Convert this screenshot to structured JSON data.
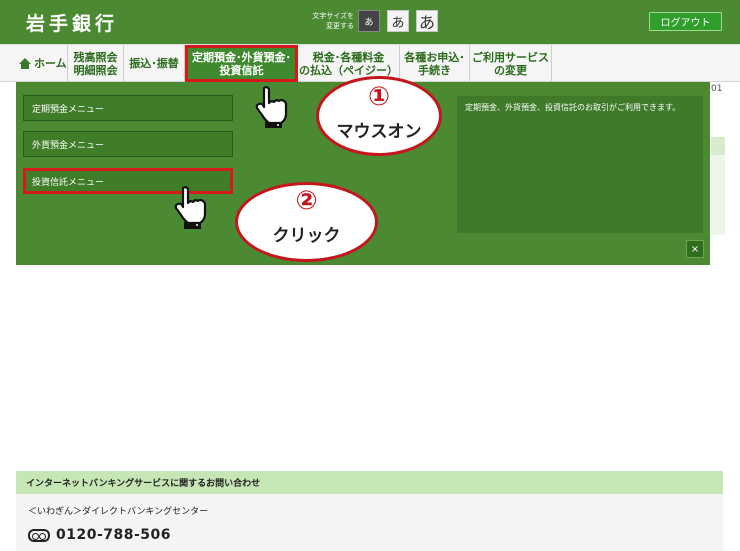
{
  "header": {
    "logo": "岩手銀行",
    "font_size_label_line1": "文字サイズを",
    "font_size_label_line2": "変更する",
    "font_buttons": [
      "あ",
      "あ",
      "あ"
    ],
    "logout_label": "ログアウト"
  },
  "nav": {
    "home": "ホーム",
    "balance_line1": "残高照会",
    "balance_line2": "明細照会",
    "transfer": "振込･振替",
    "deposit_line1": "定期預金･外貨預金･",
    "deposit_line2": "投資信託",
    "tax_line1": "税金･各種料金",
    "tax_line2": "の払込（ペイジー）",
    "apply_line1": "各種お申込･",
    "apply_line2": "手続き",
    "service_line1": "ご利用サービス",
    "service_line2": "の変更"
  },
  "side_text": "01",
  "dropdown": {
    "items": [
      "定期預金メニュー",
      "外貨預金メニュー",
      "投資信託メニュー"
    ],
    "description": "定期預金、外貨預金、投資信託のお取引がご利用できます。",
    "close": "×"
  },
  "callouts": {
    "step1_num": "①",
    "step1_text": "マウスオン",
    "step2_num": "②",
    "step2_text": "クリック"
  },
  "footer": {
    "heading": "インターネットバンキングサービスに関するお問い合わせ",
    "center_name": "＜いわぎん＞ダイレクトバンキングセンター",
    "phone": "0120-788-506"
  },
  "colors": {
    "brand_green": "#4b8a32",
    "highlight_red": "#d41a1a",
    "footer_green": "#c6e6b5"
  }
}
